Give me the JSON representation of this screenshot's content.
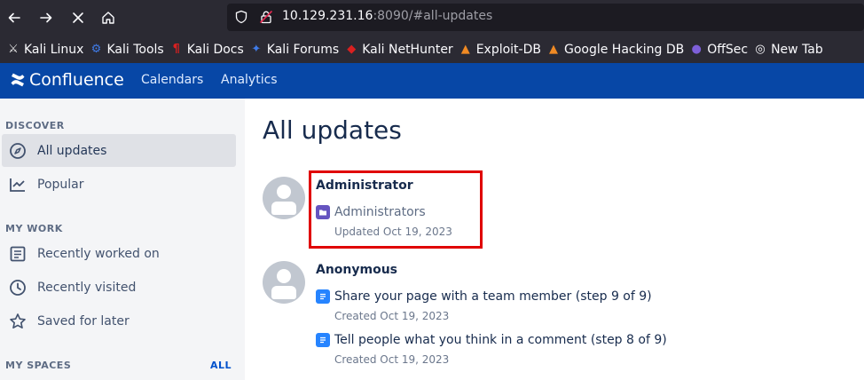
{
  "browser": {
    "url_host": "10.129.231.16",
    "url_rest": ":8090/#all-updates",
    "bookmarks": [
      {
        "label": "Kali Linux",
        "icon": "kali-dragon-icon",
        "color": "#e8e8e8"
      },
      {
        "label": "Kali Tools",
        "icon": "kali-tools-icon",
        "color": "#3f7be8"
      },
      {
        "label": "Kali Docs",
        "icon": "kali-docs-icon",
        "color": "#d92020"
      },
      {
        "label": "Kali Forums",
        "icon": "kali-forums-icon",
        "color": "#3f7be8"
      },
      {
        "label": "Kali NetHunter",
        "icon": "nethunter-icon",
        "color": "#d92020"
      },
      {
        "label": "Exploit-DB",
        "icon": "exploit-db-icon",
        "color": "#f08a24"
      },
      {
        "label": "Google Hacking DB",
        "icon": "ghdb-icon",
        "color": "#f08a24"
      },
      {
        "label": "OffSec",
        "icon": "offsec-icon",
        "color": "#7d5fd8"
      },
      {
        "label": "New Tab",
        "icon": "globe-icon",
        "color": "#fbfbfe"
      }
    ]
  },
  "header": {
    "brand": "Confluence",
    "links": [
      "Calendars",
      "Analytics"
    ]
  },
  "sidebar": {
    "discover_heading": "DISCOVER",
    "discover_items": [
      {
        "label": "All updates",
        "icon": "compass-icon",
        "active": true
      },
      {
        "label": "Popular",
        "icon": "trend-chart-icon",
        "active": false
      }
    ],
    "mywork_heading": "MY WORK",
    "mywork_items": [
      {
        "label": "Recently worked on",
        "icon": "document-list-icon"
      },
      {
        "label": "Recently visited",
        "icon": "clock-icon"
      },
      {
        "label": "Saved for later",
        "icon": "star-icon"
      }
    ],
    "spaces_heading": "MY SPACES",
    "spaces_all": "ALL"
  },
  "main": {
    "title": "All updates",
    "groups": [
      {
        "author": "Administrator",
        "items": [
          {
            "title": "Administrators",
            "type": "space",
            "meta": "Updated Oct 19, 2023"
          }
        ]
      },
      {
        "author": "Anonymous",
        "items": [
          {
            "title": "Share your page with a team member (step 9 of 9)",
            "type": "page",
            "meta": "Created Oct 19, 2023"
          },
          {
            "title": "Tell people what you think in a comment (step 8 of 9)",
            "type": "page",
            "meta": "Created Oct 19, 2023"
          }
        ]
      }
    ]
  },
  "colors": {
    "header_bg": "#0747a6",
    "highlight": "#e00000",
    "browser_chrome": "#2b2a33"
  }
}
